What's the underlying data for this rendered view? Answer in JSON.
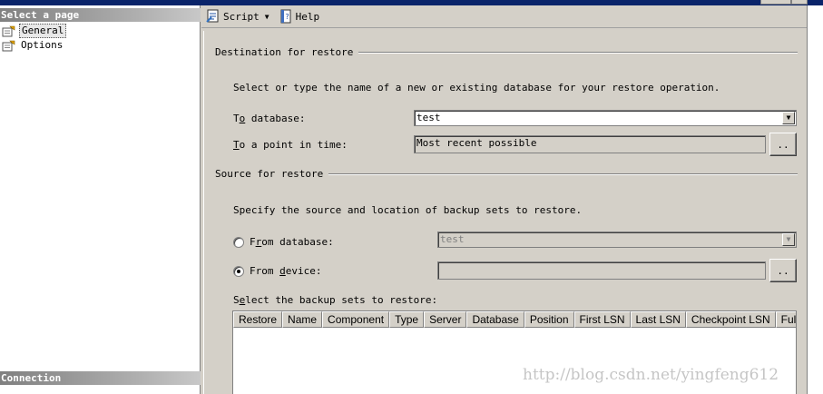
{
  "left_pane": {
    "select_header": "Select a page",
    "pages": [
      {
        "label": "General",
        "icon": "page-icon",
        "selected": true
      },
      {
        "label": "Options",
        "icon": "page-icon",
        "selected": false
      }
    ],
    "connection_header": "Connection"
  },
  "toolbar": {
    "script_label": "Script",
    "help_label": "Help"
  },
  "destination": {
    "title": "Destination for restore",
    "instruction": "Select or type the name of a new or existing database for your restore operation.",
    "to_database_label_pre": "T",
    "to_database_label_ul": "o",
    "to_database_label_post": " database:",
    "to_database_value": "test",
    "point_in_time_label_ul": "T",
    "point_in_time_label_post": "o a point in time:",
    "point_in_time_value": "Most recent possible",
    "ellipsis": ".."
  },
  "source": {
    "title": "Source for restore",
    "instruction": "Specify the source and location of backup sets to restore.",
    "from_database_pre": "F",
    "from_database_ul": "r",
    "from_database_post": "om database:",
    "from_database_value": "test",
    "from_device_pre": "From ",
    "from_device_ul": "d",
    "from_device_post": "evice:",
    "from_device_value": "",
    "selected_option": "from_device",
    "ellipsis": ".."
  },
  "backup_sets": {
    "label_pre": "S",
    "label_ul": "e",
    "label_post": "lect the backup sets to restore:",
    "columns": [
      "Restore",
      "Name",
      "Component",
      "Type",
      "Server",
      "Database",
      "Position",
      "First LSN",
      "Last LSN",
      "Checkpoint LSN",
      "Full LSN"
    ]
  },
  "watermark": "http://blog.csdn.net/yingfeng612"
}
